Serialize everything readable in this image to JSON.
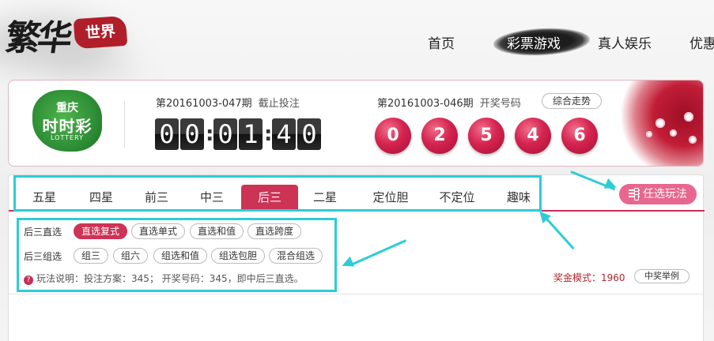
{
  "brand": {
    "calligraphy": "繁华",
    "seal": "世界"
  },
  "nav": {
    "items": [
      "首页",
      "彩票游戏",
      "真人娱乐",
      "优惠"
    ],
    "active_index": 1
  },
  "lottery": {
    "logo": {
      "line1": "重庆",
      "line2": "时时彩",
      "line3": "LOTTERY"
    },
    "current_issue": "第20161003-047期",
    "current_status": "截止投注",
    "countdown_digits": [
      "0",
      "0",
      "0",
      "1",
      "4",
      "0"
    ],
    "last_issue": "第20161003-046期",
    "last_label": "开奖号码",
    "trend_button": "综合走势",
    "balls": [
      "0",
      "2",
      "5",
      "4",
      "6"
    ],
    "ball_color": "#d4244f"
  },
  "tabs": {
    "items": [
      "五星",
      "四星",
      "前三",
      "中三",
      "后三",
      "二星",
      "定位胆",
      "不定位",
      "趣味"
    ],
    "active_index": 4
  },
  "optional_play_button": "任选玩法",
  "sub_options": {
    "row1": {
      "label": "后三直选",
      "options": [
        "直选复式",
        "直选单式",
        "直选和值",
        "直选跨度"
      ],
      "active_index": 0
    },
    "row2": {
      "label": "后三组选",
      "options": [
        "组三",
        "组六",
        "组选和值",
        "组选包胆",
        "混合组选"
      ]
    }
  },
  "info": {
    "icon": "question-icon",
    "text": "玩法说明：投注方案：345； 开奖号码：345，即中后三直选。"
  },
  "prize_mode": "奖金模式：1960",
  "example_button": "中奖举例",
  "colors": {
    "accent": "#cc3355",
    "highlight": "#2ccdd6",
    "option_button": "#e8678f"
  }
}
